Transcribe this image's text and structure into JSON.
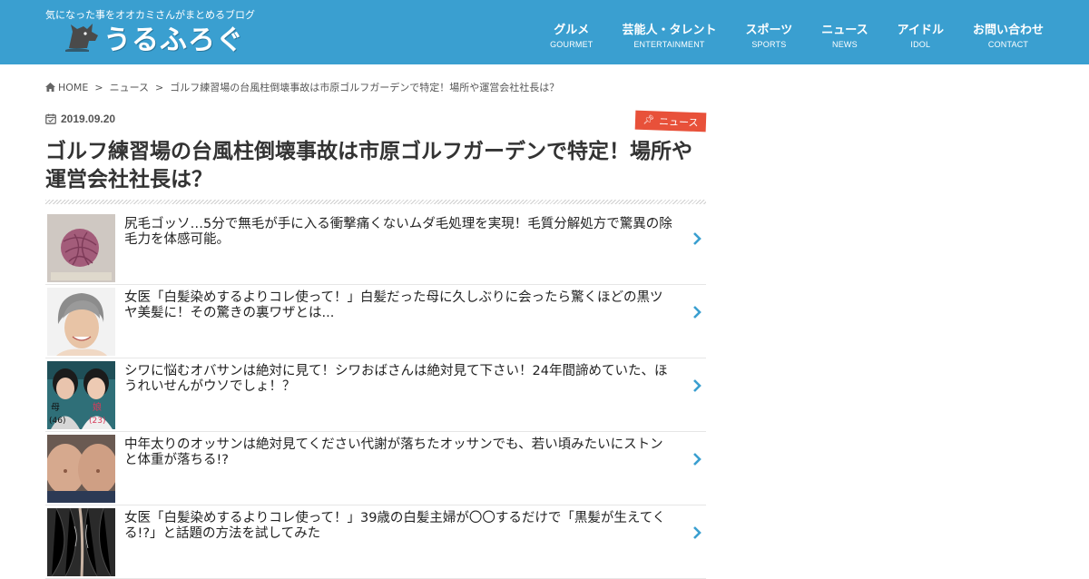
{
  "header": {
    "tagline": "気になった事をオオカミさんがまとめるブログ",
    "logo_text": "うるふろぐ",
    "nav": [
      {
        "jp": "グルメ",
        "en": "GOURMET"
      },
      {
        "jp": "芸能人・タレント",
        "en": "ENTERTAINMENT"
      },
      {
        "jp": "スポーツ",
        "en": "SPORTS"
      },
      {
        "jp": "ニュース",
        "en": "NEWS"
      },
      {
        "jp": "アイドル",
        "en": "IDOL"
      },
      {
        "jp": "お問い合わせ",
        "en": "CONTACT"
      }
    ]
  },
  "breadcrumb": {
    "home": "HOME",
    "sep": ">",
    "category": "ニュース",
    "current": "ゴルフ練習場の台風柱倒壊事故は市原ゴルフガーデンで特定！場所や運営会社社長は？"
  },
  "article": {
    "date": "2019.09.20",
    "category": "ニュース",
    "title": "ゴルフ練習場の台風柱倒壊事故は市原ゴルフガーデンで特定！場所や運営会社社長は？"
  },
  "related": [
    {
      "text": "尻毛ゴッソ…5分で無毛が手に入る衝撃痛くないムダ毛処理を実現！毛質分解処方で驚異の除毛力を体感可能。",
      "thumb": "hair-removal-thumbnail"
    },
    {
      "text": "女医「白髪染めするよりコレ使って！」白髪だった母に久しぶりに会ったら驚くほどの黒ツヤ美髪に！その驚きの裏ワザとは...",
      "thumb": "gray-hair-woman-thumbnail"
    },
    {
      "text": "シワに悩むオバサンは絶対に見て！シワおばさんは絶対見て下さい！24年間諦めていた、ほうれいせんがウソでしょ！？",
      "thumb": "mother-daughter-thumbnail",
      "thumb_labels": [
        "母",
        "(46)",
        "娘",
        "(23)"
      ]
    },
    {
      "text": "中年太りのオッサンは絶対見てください代謝が落ちたオッサンでも、若い頃みたいにストンと体重が落ちる!?",
      "thumb": "belly-thumbnail"
    },
    {
      "text": "女医「白髪染めするよりコレ使って！」39歳の白髪主婦が〇〇するだけで「黒髪が生えてくる!?」と話題の方法を試してみた",
      "thumb": "scalp-thumbnail"
    }
  ],
  "colors": {
    "header_bg": "#3a9fd0",
    "badge_bg": "#e8513a",
    "chevron": "#3a9fd0"
  }
}
